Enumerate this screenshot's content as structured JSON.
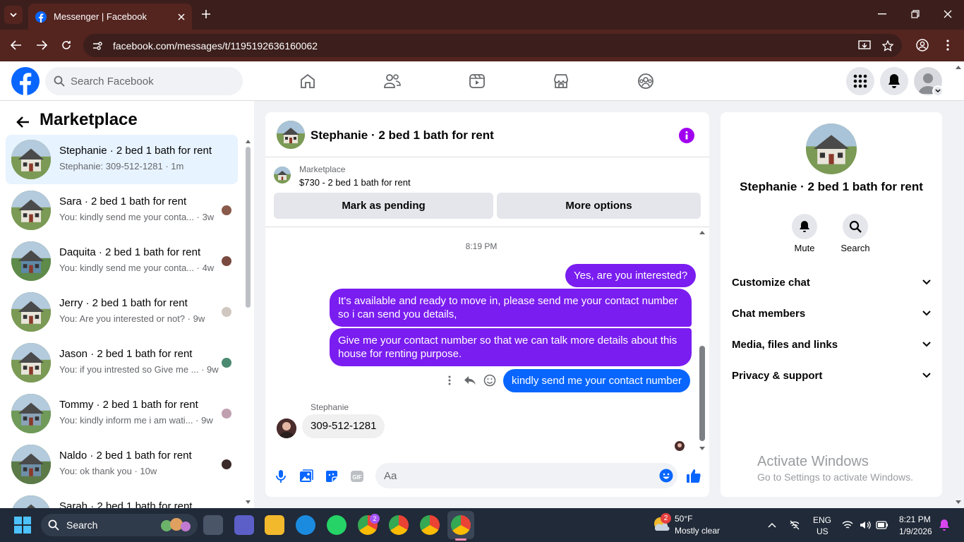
{
  "browser": {
    "tab_title": "Messenger | Facebook",
    "url": "facebook.com/messages/t/1195192636160062"
  },
  "facebook": {
    "search_placeholder": "Search Facebook"
  },
  "sidebar": {
    "title": "Marketplace",
    "conversations": [
      {
        "name": "Stephanie · 2 bed 1 bath for rent",
        "preview": "Stephanie: 309-512-1281 · 1m"
      },
      {
        "name": "Sara · 2 bed 1 bath for rent",
        "preview": "You: kindly send me your conta... · 3w"
      },
      {
        "name": "Daquita · 2 bed 1 bath for rent",
        "preview": "You: kindly send me your conta... · 4w"
      },
      {
        "name": "Jerry · 2 bed 1 bath for rent",
        "preview": "You: Are you interested or not? · 9w"
      },
      {
        "name": "Jason · 2 bed 1 bath for rent",
        "preview": "You: if you intrested so Give me ... · 9w"
      },
      {
        "name": "Tommy · 2 bed 1 bath for rent",
        "preview": "You: kindly inform me i am wati... · 9w"
      },
      {
        "name": "Naldo · 2 bed 1 bath for rent",
        "preview": "You: ok thank you · 10w"
      },
      {
        "name": "Sarah · 2 bed 1 bath for rent",
        "preview": ""
      }
    ]
  },
  "chat": {
    "header_title": "Stephanie · 2 bed 1 bath for rent",
    "listing_source": "Marketplace",
    "listing_title": "$730 - 2 bed 1 bath for rent",
    "mark_pending_label": "Mark as pending",
    "more_options_label": "More options",
    "timestamp": "8:19 PM",
    "messages": [
      {
        "from": "me",
        "text": "Yes, are you interested?"
      },
      {
        "from": "me",
        "text": "It's available and ready to move in, please send me your contact number so i can send you details,"
      },
      {
        "from": "me",
        "text": "Give me your contact number so that we can talk more details about this house for renting purpose."
      },
      {
        "from": "me",
        "text": "kindly send me your contact number"
      },
      {
        "from": "Stephanie",
        "sender_label": "Stephanie",
        "text": "309-512-1281"
      }
    ],
    "composer_placeholder": "Aa"
  },
  "info_panel": {
    "name": "Stephanie · 2 bed 1 bath for rent",
    "mute_label": "Mute",
    "search_label": "Search",
    "sections": [
      "Customize chat",
      "Chat members",
      "Media, files and links",
      "Privacy & support"
    ],
    "watermark_title": "Activate Windows",
    "watermark_sub": "Go to Settings to activate Windows."
  },
  "taskbar": {
    "search_label": "Search",
    "weather_temp": "50°F",
    "weather_desc": "Mostly clear",
    "weather_badge": "2",
    "lang_top": "ENG",
    "lang_bottom": "US",
    "time": "8:21 PM",
    "date": "1/9/2026",
    "chrome_badge": "2"
  },
  "colors": {
    "accent": "#7a1df0",
    "facebook_blue": "#0866ff",
    "browser_dark": "#3c1f1c",
    "browser_bar": "#54241f"
  }
}
